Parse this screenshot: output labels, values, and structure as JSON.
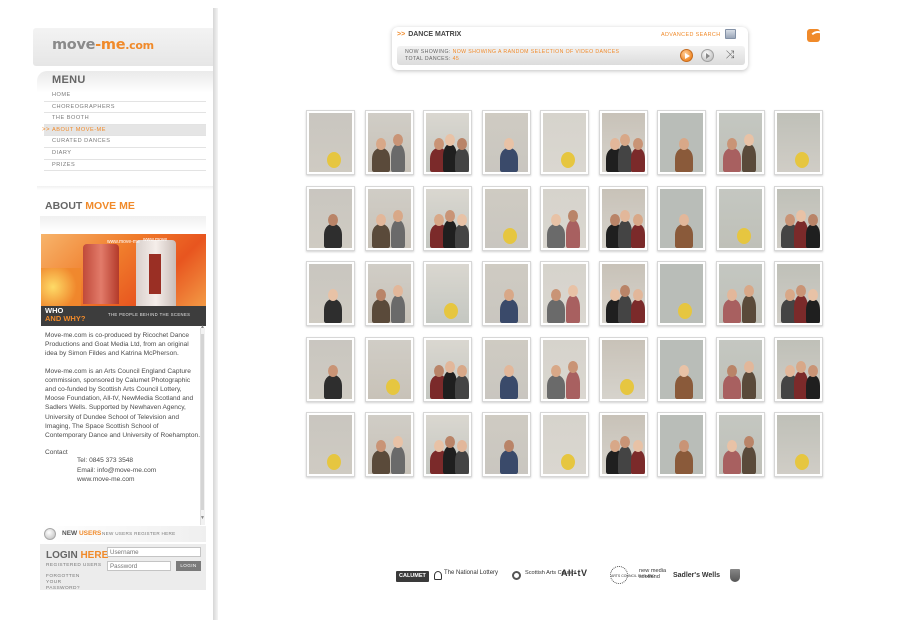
{
  "logo": {
    "part1": "move",
    "dash": "-",
    "part2": "me",
    "tld": ".com"
  },
  "menu": {
    "title": "MENU",
    "items": [
      {
        "label": "HOME",
        "active": false
      },
      {
        "label": "CHOREOGRAPHERS",
        "active": false
      },
      {
        "label": "THE BOOTH",
        "active": false
      },
      {
        "label": "ABOUT MOVE-ME",
        "active": true
      },
      {
        "label": "CURATED DANCES",
        "active": false
      },
      {
        "label": "DIARY",
        "active": false
      },
      {
        "label": "PRIZES",
        "active": false
      }
    ],
    "active_marker": ">>"
  },
  "about": {
    "title_part1": "ABOUT",
    "title_part2": "MOVE ME",
    "image": {
      "label1": "www.move-me",
      "label2": "www.move"
    },
    "who": {
      "line1": "WHO",
      "line2": "AND WHY?",
      "caption": "THE PEOPLE BEHIND THE SCENES"
    },
    "paragraph1": "Move-me.com is co-produced by Ricochet Dance Productions and Goat Media Ltd, from an original idea by Simon Fildes and Katrina McPherson.",
    "paragraph2": "Move-me.com is an Arts Council England Capture commission, sponsored by Calumet Photographic and co-funded by Scottish Arts Council Lottery, Moose Foundation, All-tV, NewMedia Scotland and Sadlers Wells. Supported by Newhaven Agency, University of Dundee School of Television and Imaging, The Space Scottish School of Contemporary Dance and University of Roehampton.",
    "contact_label": "Contact",
    "contact_tel": "Tel: 0845 373 3548",
    "contact_email": "Email: info@move-me.com",
    "contact_web": "www.move-me.com"
  },
  "new_users": {
    "part1": "NEW",
    "part2": "USERS",
    "register": "NEW USERS REGISTER HERE"
  },
  "login": {
    "title_part1": "LOGIN",
    "title_part2": "HERE",
    "registered": "REGISTERED USERS",
    "forgot": "FORGOTTEN YOUR PASSWORD?",
    "username_placeholder": "Username",
    "password_placeholder": "Password",
    "button": "LOGIN"
  },
  "matrix": {
    "arrow": ">>",
    "title": "DANCE MATRIX",
    "advanced_search": "ADVANCED SEARCH",
    "now_showing_label": "NOW SHOWING:",
    "now_showing_value": "NOW SHOWING A RANDOM SELECTION OF VIDEO DANCES",
    "total_label": "TOTAL DANCES:",
    "total_value": "45"
  },
  "thumbnail_count": 45,
  "sponsors": {
    "calumet": "CALUMET",
    "lottery": "The National Lottery",
    "scottish_arts": "Scottish Arts Council",
    "alltv": "All-tV",
    "arts_council": "ARTS COUNCIL ENGLAND",
    "newmedia": "new media scotland",
    "sadlers": "Sadler's Wells"
  },
  "colors": {
    "accent": "#f08a2a",
    "text": "#4b4b4b",
    "panel": "#ececec"
  },
  "icons": [
    "rss-icon",
    "advanced-search-icon",
    "play-icon",
    "next-icon",
    "shuffle-icon",
    "new-users-icon"
  ]
}
